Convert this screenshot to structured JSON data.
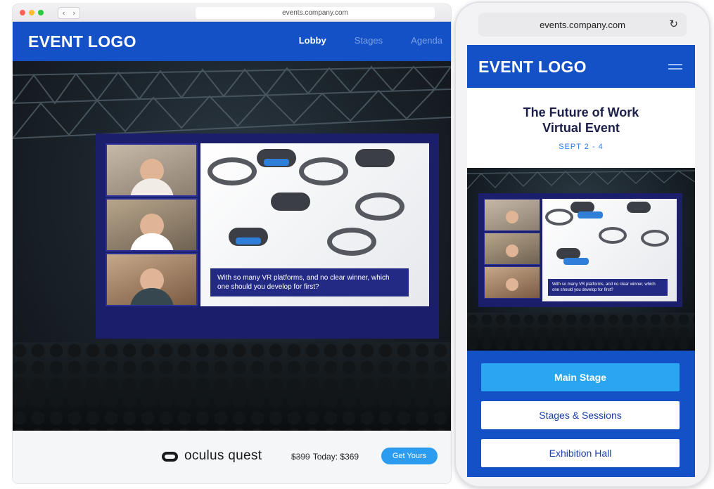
{
  "desktop": {
    "url": "events.company.com",
    "logo": "EVENT LOGO",
    "nav": [
      {
        "label": "Lobby",
        "active": true
      },
      {
        "label": "Stages",
        "active": false
      },
      {
        "label": "Agenda",
        "active": false
      }
    ],
    "slide_caption": "With so many VR platforms, and no clear winner, which one should you develop for first?",
    "promo": {
      "brand": "oculus quest",
      "old_price": "$399",
      "today_price": "Today: $369",
      "cta": "Get Yours"
    }
  },
  "mobile": {
    "url": "events.company.com",
    "logo": "EVENT LOGO",
    "title_line1": "The Future of Work",
    "title_line2": "Virtual Event",
    "date": "SEPT 2 - 4",
    "slide_caption": "With so many VR platforms, and no clear winner, which one should you develop for first?",
    "buttons": [
      "Main Stage",
      "Stages & Sessions",
      "Exhibition Hall"
    ]
  },
  "colors": {
    "brand_blue": "#1451c7",
    "accent_blue": "#2aa5ef",
    "screen_navy": "#1b1f6b"
  },
  "icons": [
    "back-chevron-icon",
    "forward-chevron-icon",
    "reload-icon",
    "hamburger-menu-icon",
    "oculus-logo-icon"
  ]
}
